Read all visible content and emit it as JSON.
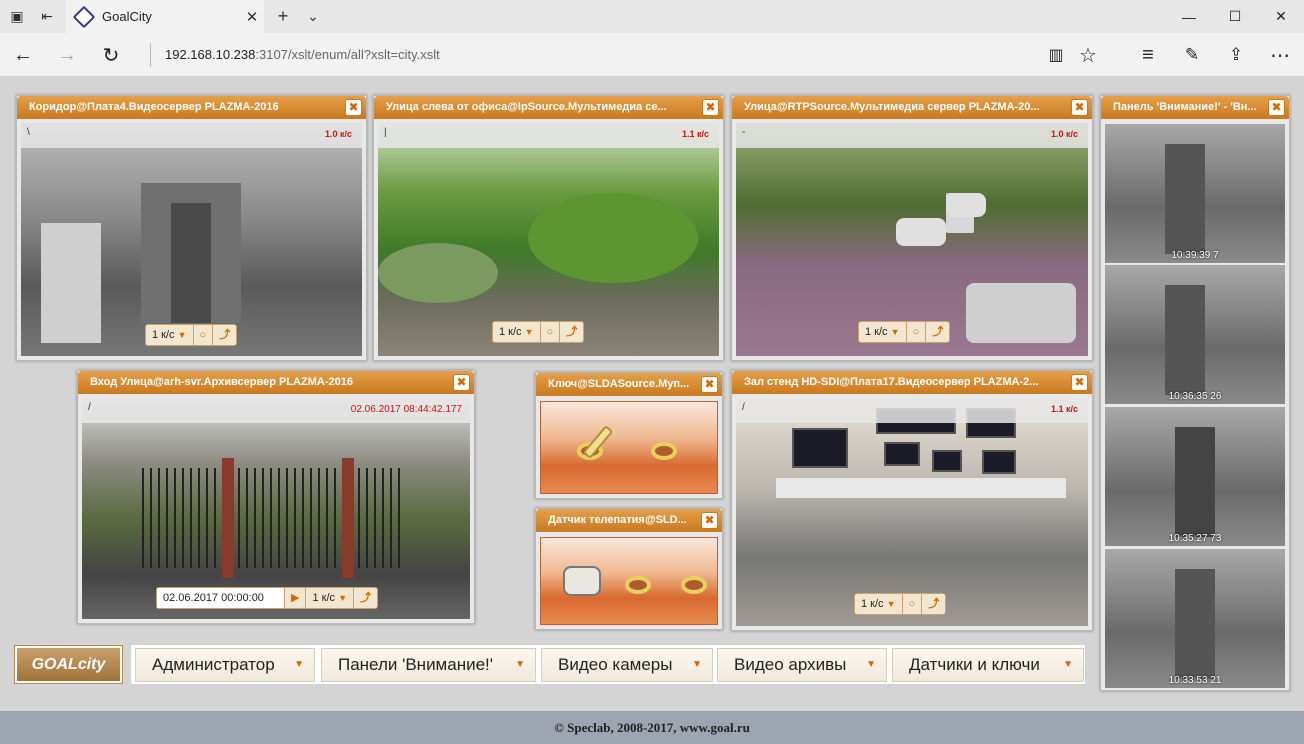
{
  "browser": {
    "tab_title": "GoalCity",
    "url_host": "192.168.10.238",
    "url_rest": ":3107/xslt/enum/all?xslt=city.xslt"
  },
  "panels": {
    "p1": {
      "title": "Коридор@Плата4.Видеосервер PLAZMA-2016",
      "info": "\\",
      "fps": "1.0 к/с",
      "rate": "1 к/с"
    },
    "p2": {
      "title": "Улица слева от офиса@IpSource.Мультимедиа се...",
      "info": "|",
      "fps": "1.1 к/с",
      "rate": "1 к/с"
    },
    "p3": {
      "title": "Улица@RTPSource.Мультимедиа сервер PLAZMA-20...",
      "info": "-",
      "fps": "1.0 к/с",
      "rate": "1 к/с"
    },
    "p4": {
      "title": "Вход Улица@arh-svr.Архивсервер PLAZMA-2016",
      "info": "/",
      "timestamp": "02.06.2017 08:44:42.177",
      "time_field": "02.06.2017 00:00:00",
      "rate": "1 к/с"
    },
    "p5": {
      "title": "Ключ@SLDASource.Муп..."
    },
    "p6": {
      "title": "Датчик телепатия@SLD..."
    },
    "p7": {
      "title": "Зал стенд HD-SDI@Плата17.Видеосервер PLAZMA-2...",
      "info": "/",
      "fps": "1.1 к/с",
      "rate": "1 к/с"
    },
    "p8": {
      "title": "Панель 'Внимание!' - 'Вн...",
      "thumbs": [
        "10:39:39 7",
        "10:36:35 26",
        "10:35:27 73",
        "10:33:53 21"
      ]
    }
  },
  "menu": {
    "logo": "GOALcity",
    "items": [
      "Администратор",
      "Панели 'Внимание!'",
      "Видео камеры",
      "Видео архивы",
      "Датчики и ключи"
    ]
  },
  "footer": "© Speclab, 2008-2017, www.goal.ru",
  "icons": {
    "close": "close-icon",
    "dropdown": "chevron-down-icon",
    "play": "play-icon",
    "stop": "stop-icon",
    "step": "step-icon"
  },
  "colors": {
    "accent": "#d98a2e",
    "fps_red": "#d01010",
    "footer_bg": "#9da5b0"
  }
}
